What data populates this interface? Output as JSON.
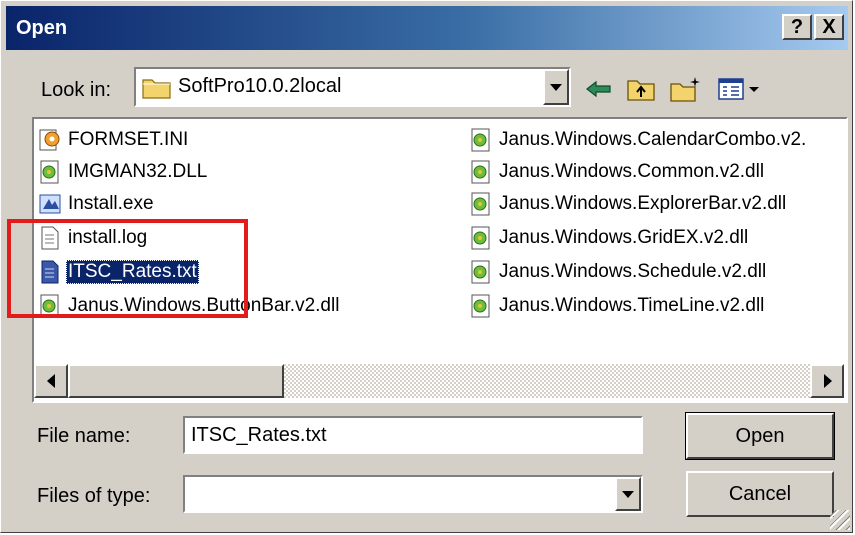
{
  "window": {
    "title": "Open",
    "help_label": "?",
    "close_label": "X"
  },
  "toolbar": {
    "look_in_label": "Look in:",
    "look_in_value": "SoftPro10.0.2local"
  },
  "files": {
    "column_left": [
      {
        "name": "FORMSET.INI",
        "icon": "ini-settings-icon"
      },
      {
        "name": "IMGMAN32.DLL",
        "icon": "dll-file-icon"
      },
      {
        "name": "Install.exe",
        "icon": "installer-exe-icon"
      },
      {
        "name": "install.log",
        "icon": "text-document-icon"
      },
      {
        "name": "ITSC_Rates.txt",
        "icon": "text-document-icon",
        "selected": true
      },
      {
        "name": "Janus.Windows.ButtonBar.v2.dll",
        "icon": "dll-file-icon"
      }
    ],
    "column_right": [
      {
        "name": "Janus.Windows.CalendarCombo.v2.",
        "icon": "dll-file-icon"
      },
      {
        "name": "Janus.Windows.Common.v2.dll",
        "icon": "dll-file-icon"
      },
      {
        "name": "Janus.Windows.ExplorerBar.v2.dll",
        "icon": "dll-file-icon"
      },
      {
        "name": "Janus.Windows.GridEX.v2.dll",
        "icon": "dll-file-icon"
      },
      {
        "name": "Janus.Windows.Schedule.v2.dll",
        "icon": "dll-file-icon"
      },
      {
        "name": "Janus.Windows.TimeLine.v2.dll",
        "icon": "dll-file-icon"
      }
    ]
  },
  "form": {
    "file_name_label": "File name:",
    "file_name_value": "ITSC_Rates.txt",
    "files_of_type_label": "Files of type:",
    "files_of_type_value": "",
    "open_button": "Open",
    "cancel_button": "Cancel"
  },
  "colors": {
    "title_gradient_start": "#0a246a",
    "title_gradient_end": "#a6caf0",
    "selection": "#0a246a",
    "annotation_box": "#e21b1b"
  }
}
